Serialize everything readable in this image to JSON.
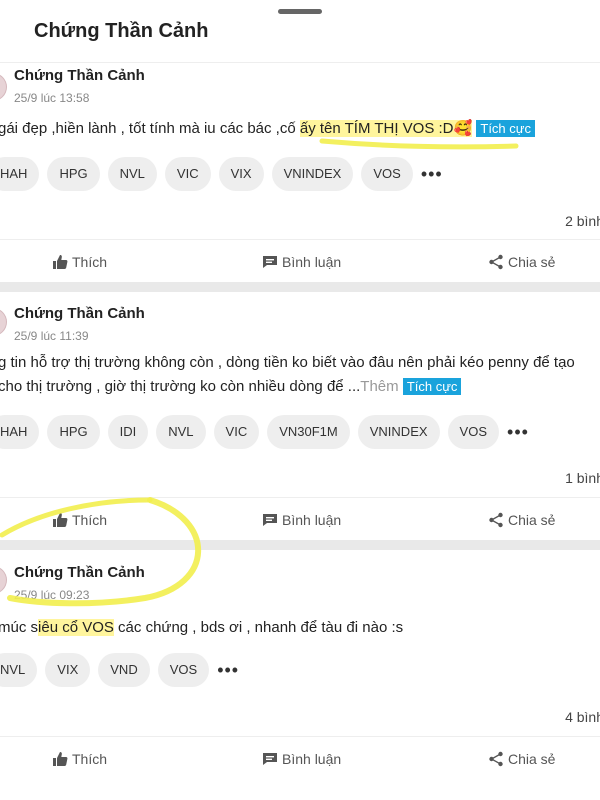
{
  "header": {
    "title": "Chứng Thần Cảnh"
  },
  "posts": [
    {
      "author": "Chứng Thần Cảnh",
      "time": "25/9 lúc 13:58",
      "content_before": "gái đẹp ,hiền lành , tốt tính mà iu các bác ,cố ",
      "content_highlight": "ấy tên TÍM THỊ VOS :D🥰",
      "content_after": " ",
      "more_link": "",
      "sentiment": "Tích cực",
      "tags": [
        "HAH",
        "HPG",
        "NVL",
        "VIC",
        "VIX",
        "VNINDEX",
        "VOS"
      ],
      "comment_count": "2 bình",
      "actions": {
        "like": "Thích",
        "comment": "Bình luận",
        "share": "Chia sẻ"
      }
    },
    {
      "author": "Chứng Thần Cảnh",
      "time": "25/9 lúc 11:39",
      "content_line1": "g tin hỗ trợ thị trường không còn , dòng tiền ko biết vào đâu nên phải kéo penny để tạo",
      "content_line2": " cho thị trường , giờ thị trường ko còn nhiều dòng để ...",
      "more_link": "Thêm",
      "sentiment": "Tích cực",
      "tags": [
        "HAH",
        "HPG",
        "IDI",
        "NVL",
        "VIC",
        "VN30F1M",
        "VNINDEX",
        "VOS"
      ],
      "comment_count": "1 bình",
      "actions": {
        "like": "Thích",
        "comment": "Bình luận",
        "share": "Chia sẻ"
      }
    },
    {
      "author": "Chứng Thần Cảnh",
      "time": "25/9 lúc 09:23",
      "content_before": "múc s",
      "content_highlight": "iêu cổ VOS",
      "content_after": " các chứng , bds ơi , nhanh để tàu đi nào :s",
      "tags": [
        "NVL",
        "VIX",
        "VND",
        "VOS"
      ],
      "comment_count": "4 bình",
      "actions": {
        "like": "Thích",
        "comment": "Bình luận",
        "share": "Chia sẻ"
      }
    }
  ],
  "colors": {
    "highlight": "#fff59d",
    "sentiment_badge": "#1aa3dc",
    "annotation_marker": "#f2ee4e",
    "separator": "#e9e9e9"
  }
}
